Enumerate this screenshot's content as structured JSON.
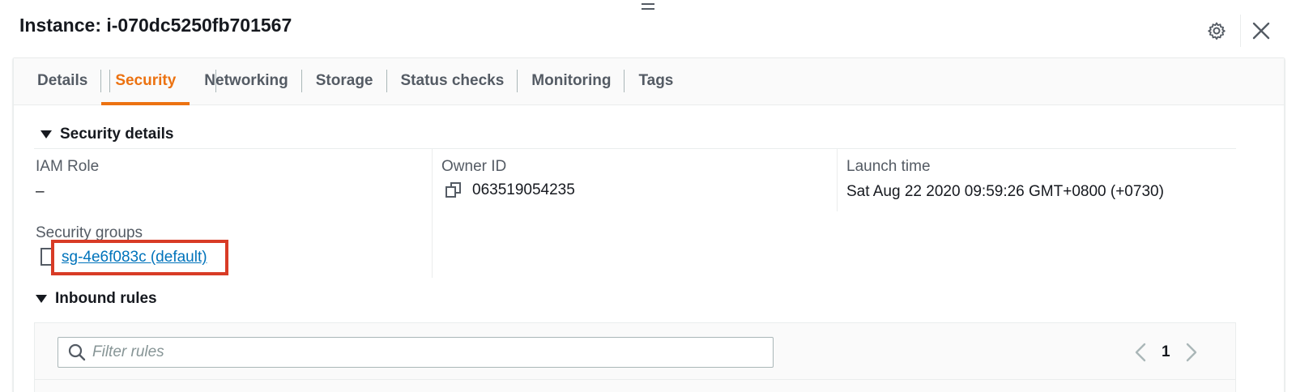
{
  "header": {
    "title": "Instance: i-070dc5250fb701567"
  },
  "tabs": [
    {
      "label": "Details",
      "active": false
    },
    {
      "label": "Security",
      "active": true
    },
    {
      "label": "Networking",
      "active": false
    },
    {
      "label": "Storage",
      "active": false
    },
    {
      "label": "Status checks",
      "active": false
    },
    {
      "label": "Monitoring",
      "active": false
    },
    {
      "label": "Tags",
      "active": false
    }
  ],
  "security_details": {
    "title": "Security details",
    "iam_role_label": "IAM Role",
    "iam_role_value": "–",
    "owner_id_label": "Owner ID",
    "owner_id_value": "063519054235",
    "launch_time_label": "Launch time",
    "launch_time_value": "Sat Aug 22 2020 09:59:26 GMT+0800 (+0730)",
    "security_groups_label": "Security groups",
    "security_group_link": "sg-4e6f083c (default)"
  },
  "inbound_rules": {
    "title": "Inbound rules",
    "filter_placeholder": "Filter rules",
    "page_number": "1"
  },
  "icons": {
    "settings": "gear-icon",
    "close": "close-icon",
    "copy": "copy-icon",
    "search": "search-icon",
    "prev": "chevron-left-icon",
    "next": "chevron-right-icon",
    "expand": "caret-down-icon"
  },
  "colors": {
    "accent": "#ec7211",
    "link": "#0073bb",
    "highlight_box": "#d83b26"
  }
}
